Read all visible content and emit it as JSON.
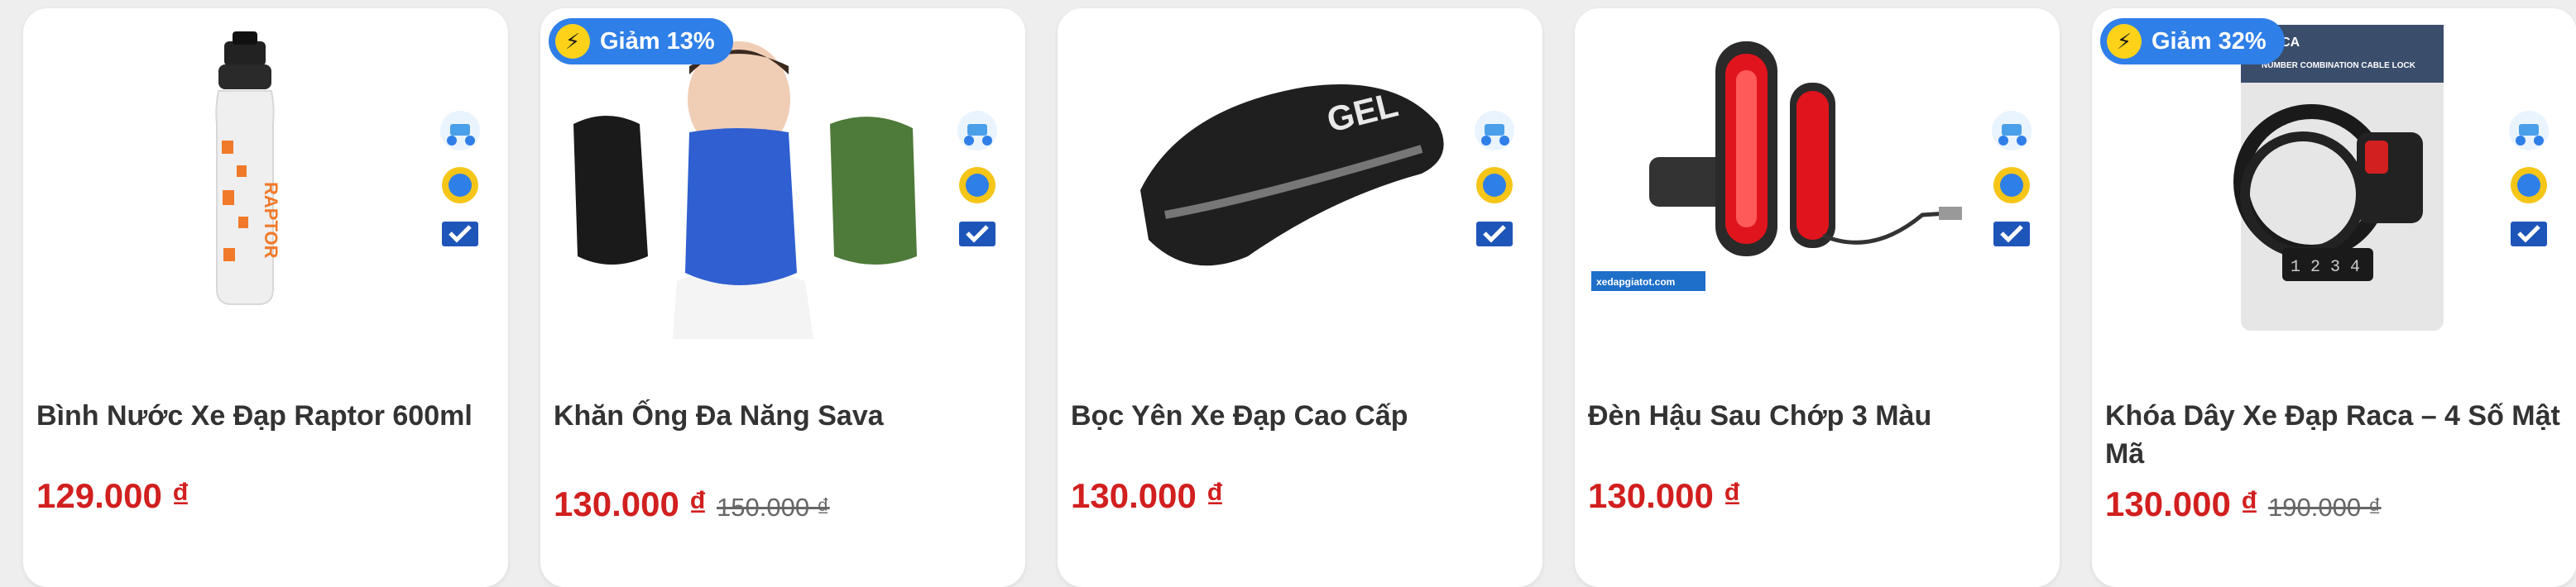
{
  "colors": {
    "price": "#d21f1f",
    "badge_bg": "#2f7fe8",
    "badge_bolt": "#ffd21a",
    "title": "#333333",
    "card_bg": "#ffffff"
  },
  "products": [
    {
      "title": "Bình Nước Xe Đạp Raptor 600ml",
      "price": "129.000 ₫",
      "image_text": "RAPTOR",
      "icon": "water-bottle-icon"
    },
    {
      "title": "Khăn Ống Đa Năng Sava",
      "price": "130.000 ₫",
      "old_price": "150.000 ₫",
      "badge": "Giảm 13%",
      "icon": "neck-gaiter-icon"
    },
    {
      "title": "Bọc Yên Xe Đạp Cao Cấp",
      "price": "130.000 ₫",
      "image_text": "GEL",
      "icon": "saddle-cover-icon"
    },
    {
      "title": "Đèn Hậu Sau Chớp 3 Màu",
      "price": "130.000 ₫",
      "image_text": "xedapgiatot.com",
      "icon": "tail-light-icon"
    },
    {
      "title": "Khóa Dây Xe Đạp Raca – 4 Số Mật Mã",
      "price": "130.000 ₫",
      "old_price": "190.000 ₫",
      "badge": "Giảm 32%",
      "image_text": "NUMBER COMBINATION CABLE LOCK",
      "image_brand": "RACA",
      "icon": "cable-lock-icon"
    }
  ]
}
